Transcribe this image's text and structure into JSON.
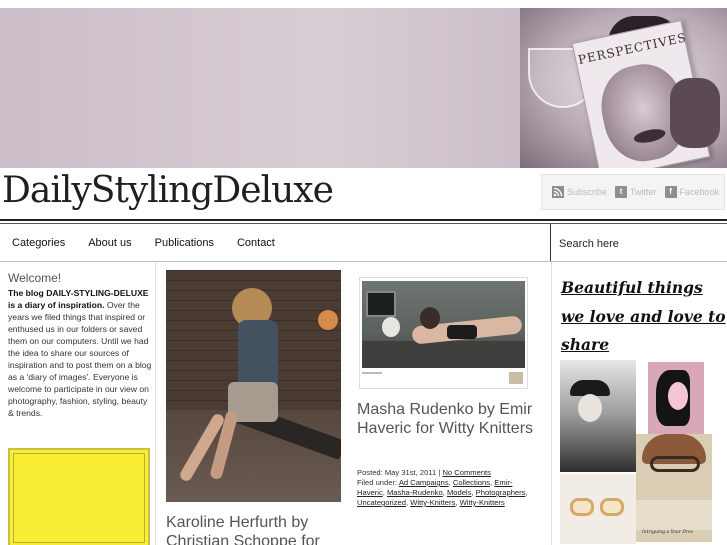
{
  "header": {
    "magazine_title": "PERSPECTIVES",
    "logo": "DailyStylingDeluxe",
    "social": [
      {
        "label": "Subscribe",
        "icon": "rss-icon",
        "glyph": ""
      },
      {
        "label": "Twitter",
        "icon": "twitter-icon",
        "glyph": "t"
      },
      {
        "label": "Facebook",
        "icon": "facebook-icon",
        "glyph": "f"
      }
    ]
  },
  "nav": {
    "items": [
      "Categories",
      "About us",
      "Publications",
      "Contact"
    ],
    "search_placeholder": "Search here"
  },
  "sidebar_left": {
    "welcome_title": "Welcome!",
    "welcome_bold": "The blog DAILY-STYLING-DELUXE is a diary of inspiration.",
    "welcome_text": "Over the years we filed things that inspired or enthused us in our folders or saved them on our computers. Until we had the idea to share our sources of inspiration and to post them on a blog as a 'diary of images'. Everyone is welcome to participate in our view on photography, fashion, styling, beauty & trends."
  },
  "posts": [
    {
      "title": "Karoline Herfurth by Christian Schoppe for"
    },
    {
      "title": "Masha Rudenko by Emir Haveric for Witty Knitters",
      "posted_label": "Posted: May 31st, 2011 |",
      "comments": "No Comments",
      "filed_label": "Filed under:",
      "tags": [
        "Ad Campaigns",
        "Collections",
        "Emir-Haveric",
        "Masha-Rudenko",
        "Models",
        "Photographers",
        "Uncategorized",
        "Witty-Knitters",
        "Witty-Knitters"
      ]
    }
  ],
  "sidebar_right": {
    "heading": "Beautiful things we love and love to share",
    "collage_caption": "Intriguing a Your Dres"
  },
  "colors": {
    "banner": "#cdbfc9",
    "yellow_box": "#f9ee33",
    "text": "#333333"
  }
}
